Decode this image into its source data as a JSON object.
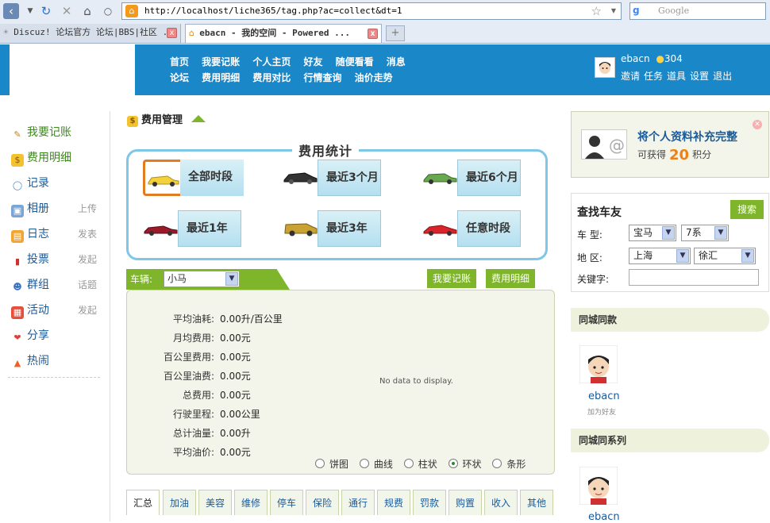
{
  "browser": {
    "url": "http://localhost/liche365/tag.php?ac=collect&dt=1",
    "search_placeholder": "Google",
    "tabs": [
      {
        "label": "Discuz! 论坛官方 论坛|BBS|社区 ..."
      },
      {
        "label": "ebacn - 我的空间 - Powered ..."
      }
    ]
  },
  "header": {
    "nav_row1": [
      "首页",
      "我要记账",
      "个人主页",
      "好友",
      "随便看看",
      "消息"
    ],
    "nav_row2": [
      "论坛",
      "费用明细",
      "费用对比",
      "行情查询",
      "油价走势"
    ],
    "username": "ebacn",
    "credits": "304",
    "user_links": [
      "邀请",
      "任务",
      "道具",
      "设置",
      "退出"
    ]
  },
  "sidebar": {
    "items": [
      {
        "label": "我要记账",
        "icon": "pencil-icon",
        "aux": ""
      },
      {
        "label": "费用明细",
        "icon": "coin-icon",
        "aux": ""
      },
      {
        "label": "记录",
        "icon": "chat-bubble-icon",
        "aux": ""
      },
      {
        "label": "相册",
        "icon": "photo-icon",
        "aux": "上传"
      },
      {
        "label": "日志",
        "icon": "notebook-icon",
        "aux": "发表"
      },
      {
        "label": "投票",
        "icon": "bar-chart-icon",
        "aux": "发起"
      },
      {
        "label": "群组",
        "icon": "group-icon",
        "aux": "话题"
      },
      {
        "label": "活动",
        "icon": "calendar-icon",
        "aux": "发起"
      },
      {
        "label": "分享",
        "icon": "heart-icon",
        "aux": ""
      },
      {
        "label": "热闹",
        "icon": "fire-icon",
        "aux": ""
      }
    ]
  },
  "main": {
    "title": "费用管理",
    "stats_title": "费用统计",
    "periods": [
      "全部时段",
      "最近3个月",
      "最近6个月",
      "最近1年",
      "最近3年",
      "任意时段"
    ],
    "selected_period": "全部时段",
    "car_label": "车辆:",
    "car_value": "小马",
    "btn_record": "我要记账",
    "btn_detail": "费用明细",
    "stats": [
      {
        "key": "平均油耗:",
        "value": "0.00升/百公里"
      },
      {
        "key": "月均费用:",
        "value": "0.00元"
      },
      {
        "key": "百公里费用:",
        "value": "0.00元"
      },
      {
        "key": "百公里油费:",
        "value": "0.00元"
      },
      {
        "key": "总费用:",
        "value": "0.00元"
      },
      {
        "key": "行驶里程:",
        "value": "0.00公里"
      },
      {
        "key": "总计油量:",
        "value": "0.00升"
      },
      {
        "key": "平均油价:",
        "value": "0.00元"
      }
    ],
    "no_data": "No data to display.",
    "chart_types": [
      "饼图",
      "曲线",
      "柱状",
      "环状",
      "条形"
    ],
    "selected_chart_type": "环状",
    "category_tabs": [
      "汇总",
      "加油",
      "美容",
      "维修",
      "停车",
      "保险",
      "通行",
      "规费",
      "罚款",
      "购置",
      "收入",
      "其他"
    ]
  },
  "right": {
    "profile_title": "将个人资料补充完整",
    "profile_sub_prefix": "可获得",
    "profile_points": "20",
    "profile_sub_suffix": "积分",
    "find_title": "查找车友",
    "find_search": "搜索",
    "label_model": "车  型:",
    "model_brand": "宝马",
    "model_series": "7系",
    "label_region": "地  区:",
    "region_city": "上海",
    "region_district": "徐汇",
    "label_keyword": "关键字:",
    "same_city_same_model": "同城同款",
    "same_city_same_series": "同城同系列",
    "friend1_name": "ebacn",
    "friend1_add": "加为好友",
    "friend2_name": "ebacn"
  },
  "colors": {
    "header_blue": "#1a87c8",
    "accent_green": "#7fb52b",
    "selected_orange": "#e27c22",
    "points_orange": "#f08010"
  }
}
